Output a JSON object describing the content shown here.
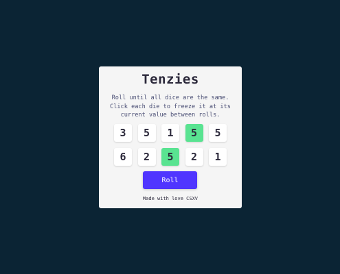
{
  "app": {
    "title": "Tenzies",
    "instructions": "Roll until all dice are the same. Click each die to freeze it at its current value between rolls.",
    "roll_label": "Roll",
    "footer": "Made with love CSXV"
  },
  "dice": [
    {
      "value": "3",
      "held": false
    },
    {
      "value": "5",
      "held": false
    },
    {
      "value": "1",
      "held": false
    },
    {
      "value": "5",
      "held": true
    },
    {
      "value": "5",
      "held": false
    },
    {
      "value": "6",
      "held": false
    },
    {
      "value": "2",
      "held": false
    },
    {
      "value": "5",
      "held": true
    },
    {
      "value": "2",
      "held": false
    },
    {
      "value": "1",
      "held": false
    }
  ],
  "colors": {
    "background": "#0b2434",
    "card": "#f5f5f5",
    "held_die": "#59e391",
    "die": "#ffffff",
    "button": "#5035ff"
  }
}
